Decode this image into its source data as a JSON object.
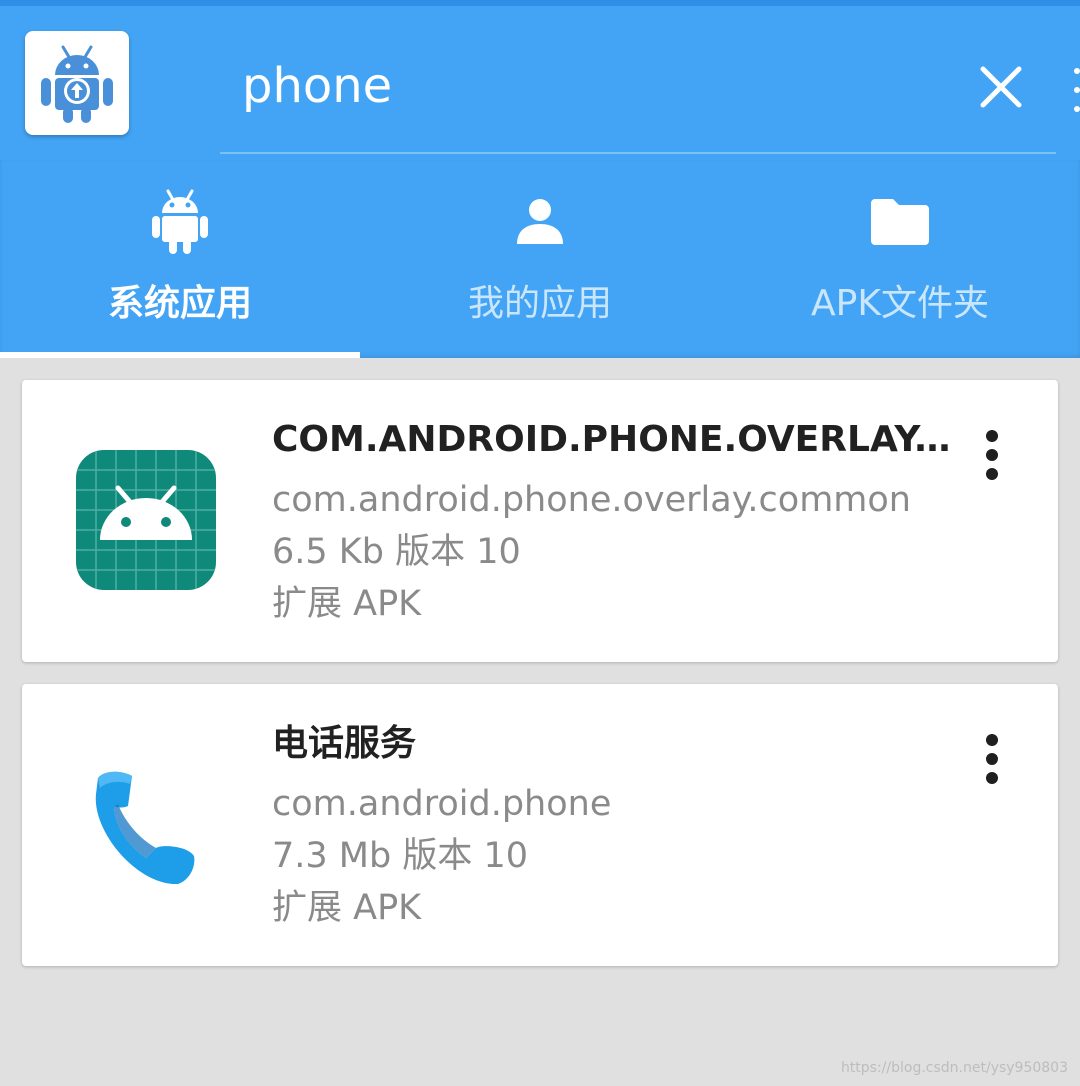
{
  "search": {
    "value": "phone",
    "clear_icon": "close-icon"
  },
  "app": {
    "logo_icon": "android-upload-logo-icon"
  },
  "tabs": [
    {
      "label": "系统应用",
      "icon": "android-icon",
      "active": true
    },
    {
      "label": "我的应用",
      "icon": "person-icon",
      "active": false
    },
    {
      "label": "APK文件夹",
      "icon": "folder-icon",
      "active": false
    }
  ],
  "list": {
    "items": [
      {
        "title": "COM.ANDROID.PHONE.OVERLAY.COMMON",
        "package": "com.android.phone.overlay.common",
        "size_version": "6.5 Kb 版本 10",
        "type": "扩展 APK",
        "icon": "android-app-icon"
      },
      {
        "title": "电话服务",
        "package": "com.android.phone",
        "size_version": "7.3 Mb 版本 10",
        "type": "扩展 APK",
        "icon": "phone-icon"
      }
    ]
  },
  "watermark": "https://blog.csdn.net/ysy950803",
  "colors": {
    "primary": "#43a4f5",
    "background": "#e0e0e0",
    "android_icon_bg": "#0f8a7a"
  }
}
